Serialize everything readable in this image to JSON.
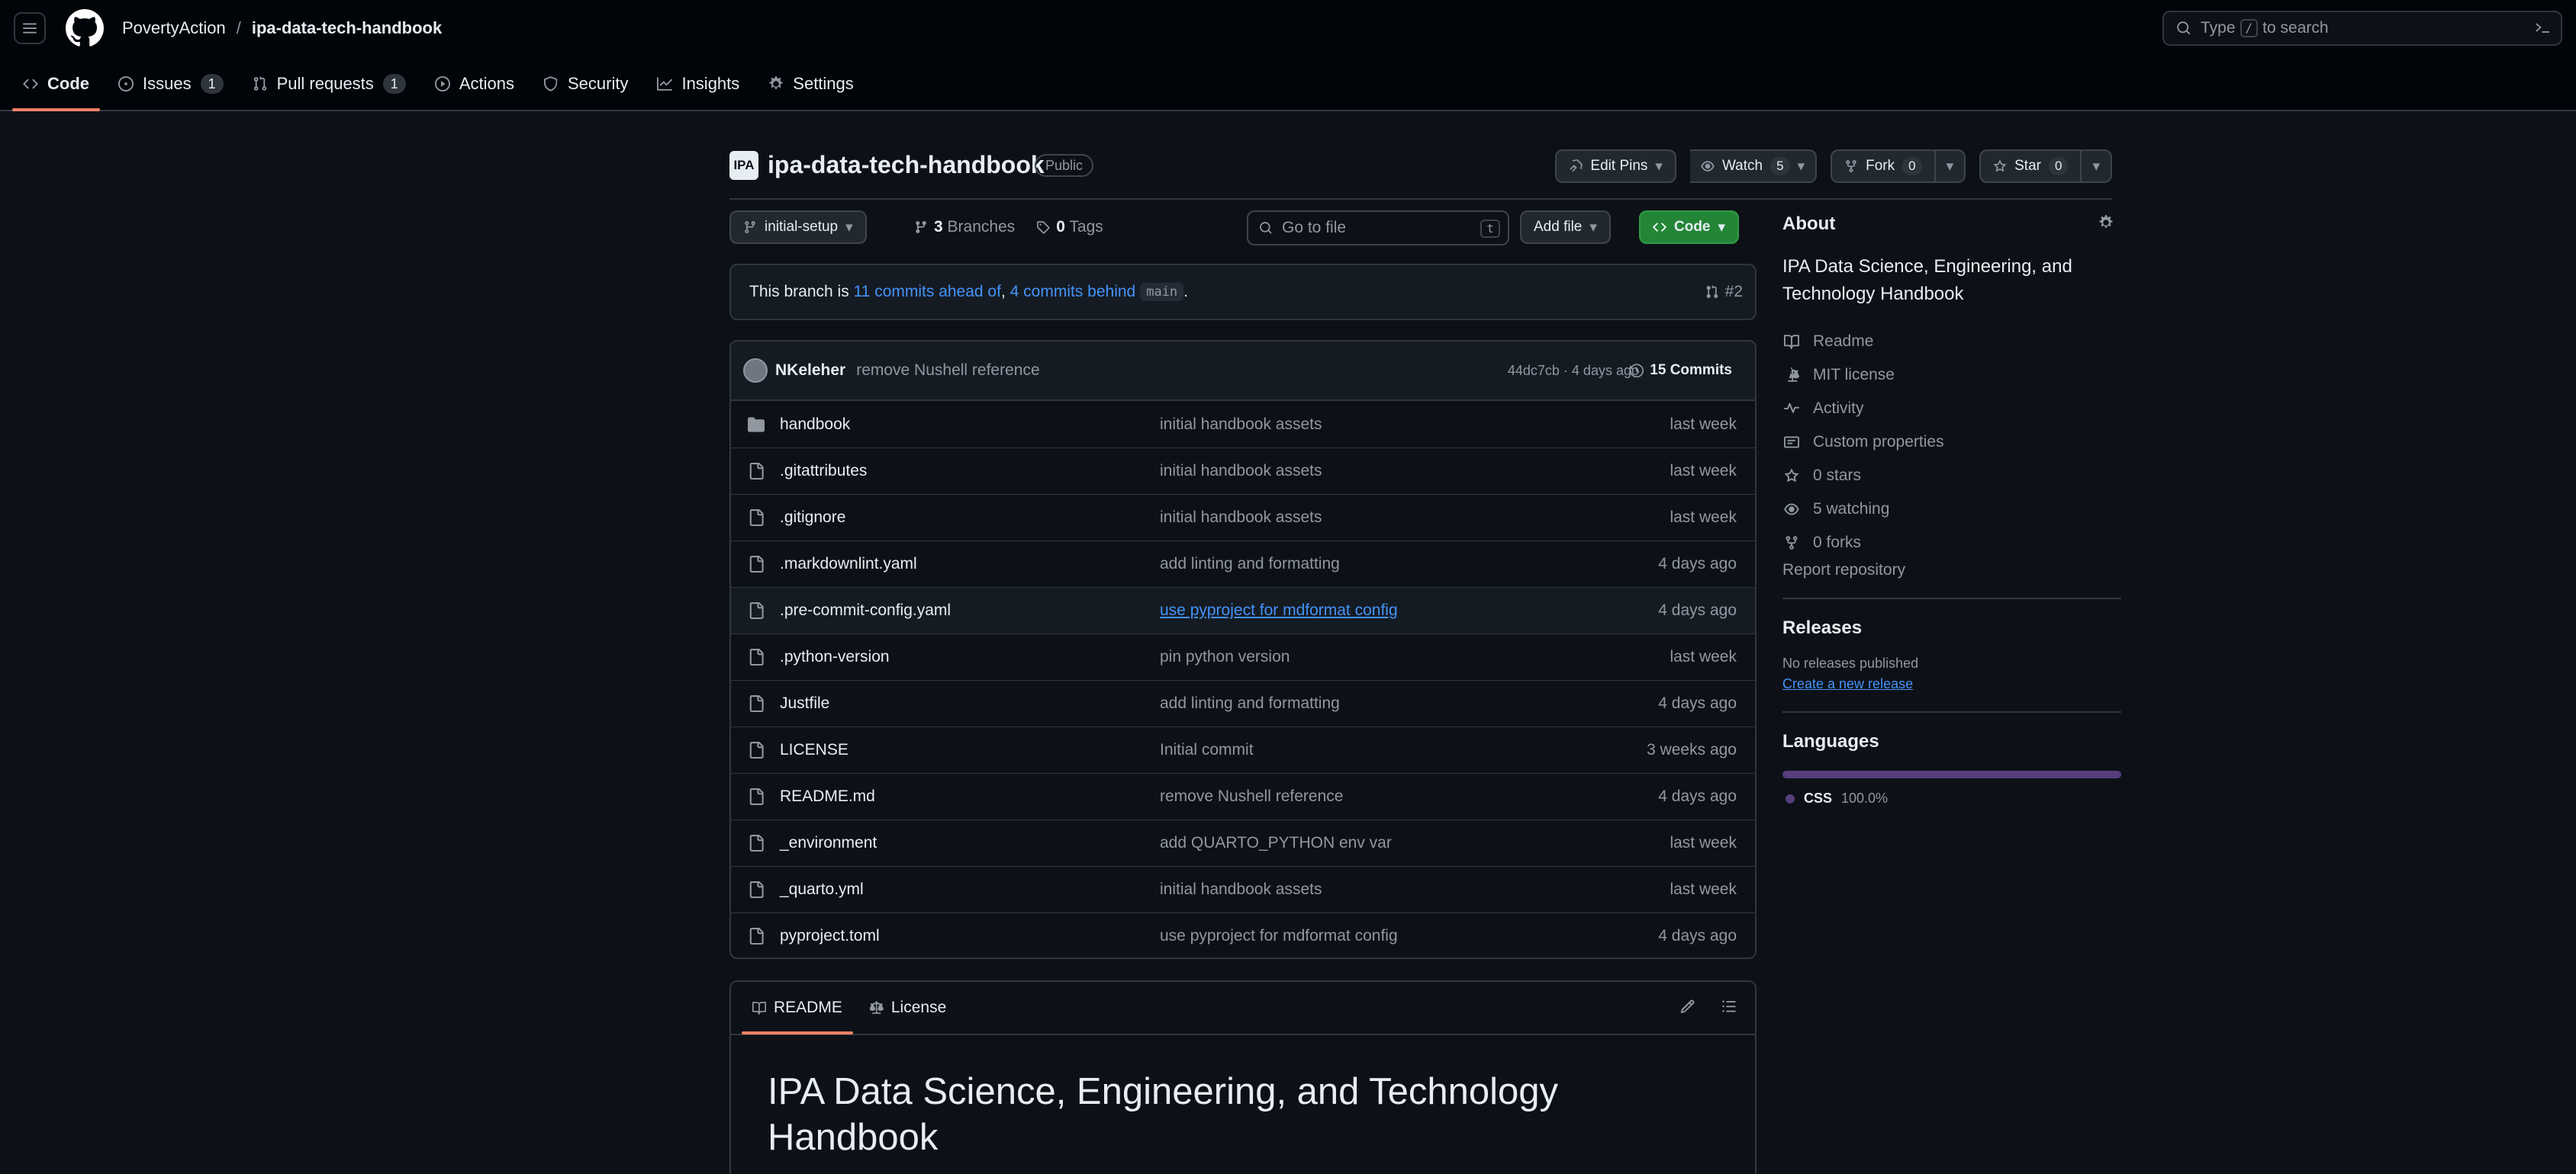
{
  "header": {
    "owner": "PovertyAction",
    "separator": "/",
    "repo": "ipa-data-tech-handbook",
    "search_prefix": "Type",
    "search_key": "/",
    "search_suffix": "to search"
  },
  "tabs": [
    {
      "label": "Code",
      "icon": "code-icon"
    },
    {
      "label": "Issues",
      "icon": "issue-icon",
      "count": "1"
    },
    {
      "label": "Pull requests",
      "icon": "pull-request-icon",
      "count": "1"
    },
    {
      "label": "Actions",
      "icon": "play-icon"
    },
    {
      "label": "Security",
      "icon": "shield-icon"
    },
    {
      "label": "Insights",
      "icon": "graph-icon"
    },
    {
      "label": "Settings",
      "icon": "gear-icon"
    }
  ],
  "repo_header": {
    "avatar_text": "IPA",
    "name": "ipa-data-tech-handbook",
    "visibility": "Public",
    "edit_pins": "Edit Pins",
    "watch": "Watch",
    "watch_count": "5",
    "fork": "Fork",
    "fork_count": "0",
    "star": "Star",
    "star_count": "0"
  },
  "file_nav": {
    "branch": "initial-setup",
    "branches_count": "3",
    "branches_label": "Branches",
    "tags_count": "0",
    "tags_label": "Tags",
    "goto_placeholder": "Go to file",
    "goto_key": "t",
    "add_file": "Add file",
    "code": "Code"
  },
  "banner": {
    "prefix": "This branch is",
    "ahead": "11 commits ahead of",
    "comma": ",",
    "behind": "4 commits behind",
    "base": "main",
    "period": ".",
    "pr": "#2"
  },
  "latest_commit": {
    "author": "NKeleher",
    "message": "remove Nushell reference",
    "meta": "44dc7cb · 4 days ago",
    "count_label": "15 Commits"
  },
  "files": [
    {
      "name": "handbook",
      "type": "folder",
      "message": "initial handbook assets",
      "date": "last week"
    },
    {
      "name": ".gitattributes",
      "type": "file",
      "message": "initial handbook assets",
      "date": "last week"
    },
    {
      "name": ".gitignore",
      "type": "file",
      "message": "initial handbook assets",
      "date": "last week"
    },
    {
      "name": ".markdownlint.yaml",
      "type": "file",
      "message": "add linting and formatting",
      "date": "4 days ago"
    },
    {
      "name": ".pre-commit-config.yaml",
      "type": "file",
      "message": "use pyproject for mdformat config",
      "date": "4 days ago"
    },
    {
      "name": ".python-version",
      "type": "file",
      "message": "pin python version",
      "date": "last week"
    },
    {
      "name": "Justfile",
      "type": "file",
      "message": "add linting and formatting",
      "date": "4 days ago"
    },
    {
      "name": "LICENSE",
      "type": "file",
      "message": "Initial commit",
      "date": "3 weeks ago"
    },
    {
      "name": "README.md",
      "type": "file",
      "message": "remove Nushell reference",
      "date": "4 days ago"
    },
    {
      "name": "_environment",
      "type": "file",
      "message": "add QUARTO_PYTHON env var",
      "date": "last week"
    },
    {
      "name": "_quarto.yml",
      "type": "file",
      "message": "initial handbook assets",
      "date": "last week"
    },
    {
      "name": "pyproject.toml",
      "type": "file",
      "message": "use pyproject for mdformat config",
      "date": "4 days ago"
    }
  ],
  "readme": {
    "tab_readme": "README",
    "tab_license": "License",
    "title": "IPA Data Science, Engineering, and Technology Handbook"
  },
  "about": {
    "title": "About",
    "description": "IPA Data Science, Engineering, and Technology Handbook",
    "items": [
      {
        "label": "Readme",
        "icon": "book-icon"
      },
      {
        "label": "MIT license",
        "icon": "law-icon"
      },
      {
        "label": "Activity",
        "icon": "pulse-icon"
      },
      {
        "label": "Custom properties",
        "icon": "note-icon"
      },
      {
        "label": "0 stars",
        "icon": "star-icon"
      },
      {
        "label": "5 watching",
        "icon": "eye-icon"
      },
      {
        "label": "0 forks",
        "icon": "fork-icon"
      }
    ],
    "report": "Report repository"
  },
  "releases": {
    "title": "Releases",
    "empty": "No releases published",
    "create": "Create a new release"
  },
  "languages": {
    "title": "Languages",
    "items": [
      {
        "name": "CSS",
        "percent": "100.0%",
        "fraction": 1.0,
        "color": "#563d7c"
      }
    ]
  }
}
